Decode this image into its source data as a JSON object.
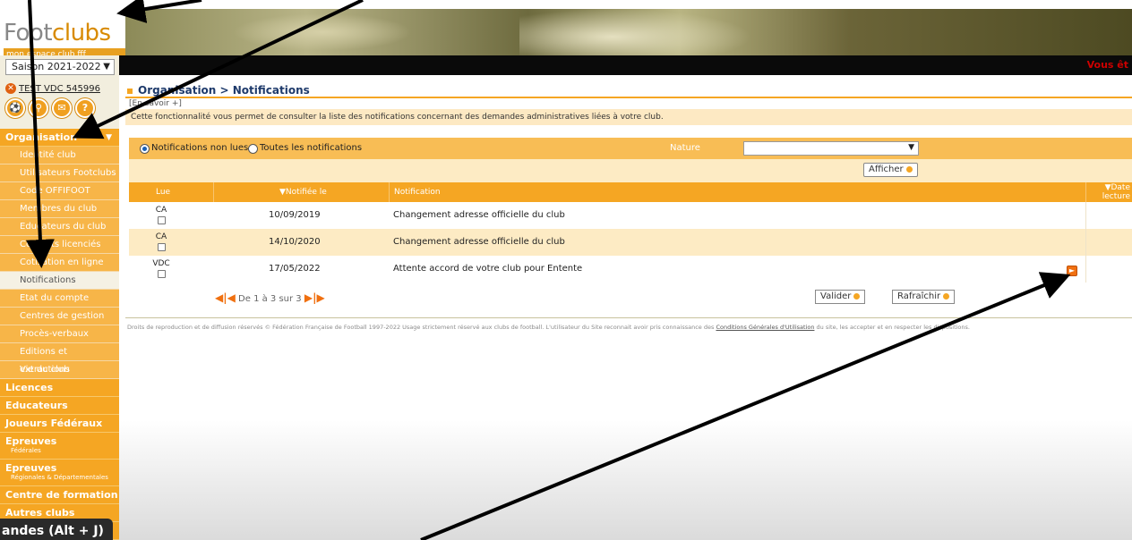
{
  "header": {
    "logo_main": "Foot",
    "logo_accent": "clubs",
    "logo_sub": "mon espace club fff",
    "welcome": "Vous êt"
  },
  "sidebar": {
    "season": "Saison 2021-2022",
    "user": "TEST VDC 545996",
    "menu": [
      {
        "label": "Organisation",
        "type": "section"
      },
      {
        "label": "Identité club",
        "type": "item"
      },
      {
        "label": "Utilisateurs Footclubs",
        "type": "item"
      },
      {
        "label": "Code OFFIFOOT",
        "type": "item"
      },
      {
        "label": "Membres du club",
        "type": "item"
      },
      {
        "label": "Educateurs du club",
        "type": "item"
      },
      {
        "label": "Contacts licenciés",
        "type": "item"
      },
      {
        "label": "Cotisation en ligne",
        "type": "item"
      },
      {
        "label": "Notifications",
        "type": "item"
      },
      {
        "label": "Etat du compte",
        "type": "item"
      },
      {
        "label": "Centres de gestion",
        "type": "item"
      },
      {
        "label": "Procès-verbaux",
        "type": "item"
      },
      {
        "label": "Editions et extractions",
        "type": "item"
      },
      {
        "label": "Vie du club",
        "type": "item"
      },
      {
        "label": "Licences",
        "type": "section"
      },
      {
        "label": "Educateurs",
        "type": "section"
      },
      {
        "label": "Joueurs Fédéraux",
        "type": "section"
      },
      {
        "label": "Epreuves",
        "sub": "Fédérales",
        "type": "section"
      },
      {
        "label": "Epreuves",
        "sub": "Régionales & Départementales",
        "type": "section"
      },
      {
        "label": "Centre de formation",
        "type": "section"
      },
      {
        "label": "Autres clubs",
        "type": "section"
      },
      {
        "label": "Divers",
        "type": "section"
      }
    ]
  },
  "shortcut_tooltip": "andes (Alt + J)",
  "main": {
    "breadcrumb": "Organisation > Notifications",
    "more_link": "[En savoir +]",
    "description": "Cette fonctionnalité vous permet de consulter la liste des notifications concernant des demandes administratives liées à votre club.",
    "filter": {
      "radio_unread": "Notifications non lues",
      "radio_all": "Toutes les notifications",
      "nature_label": "Nature",
      "nature_value": "",
      "show_button": "Afficher"
    },
    "table": {
      "headers": [
        "Lue",
        "▼Notifiée le",
        "Notification",
        "▼Date lecture"
      ],
      "rows": [
        {
          "code": "CA",
          "date": "10/09/2019",
          "notification": "Changement adresse officielle du club"
        },
        {
          "code": "CA",
          "date": "14/10/2020",
          "notification": "Changement adresse officielle du club"
        },
        {
          "code": "VDC",
          "date": "17/05/2022",
          "notification": "Attente accord de votre club pour Entente"
        }
      ]
    },
    "pager": "De 1 à 3 sur 3",
    "validate_button": "Valider",
    "refresh_button": "Rafraîchir",
    "footer_text": "Droits de reproduction et de diffusion réservés © Fédération Française de Football 1997-2022 Usage strictement réservé aux clubs de football. L'utilisateur du Site reconnait avoir pris connaissance des ",
    "footer_link": "Conditions Générales d'Utilisation",
    "footer_tail": " du site, les accepter et en respecter les dispositions."
  },
  "colors": {
    "accent": "#f5a623",
    "nav_text": "#1e3a6b",
    "annotation_arrow": "#000000"
  }
}
